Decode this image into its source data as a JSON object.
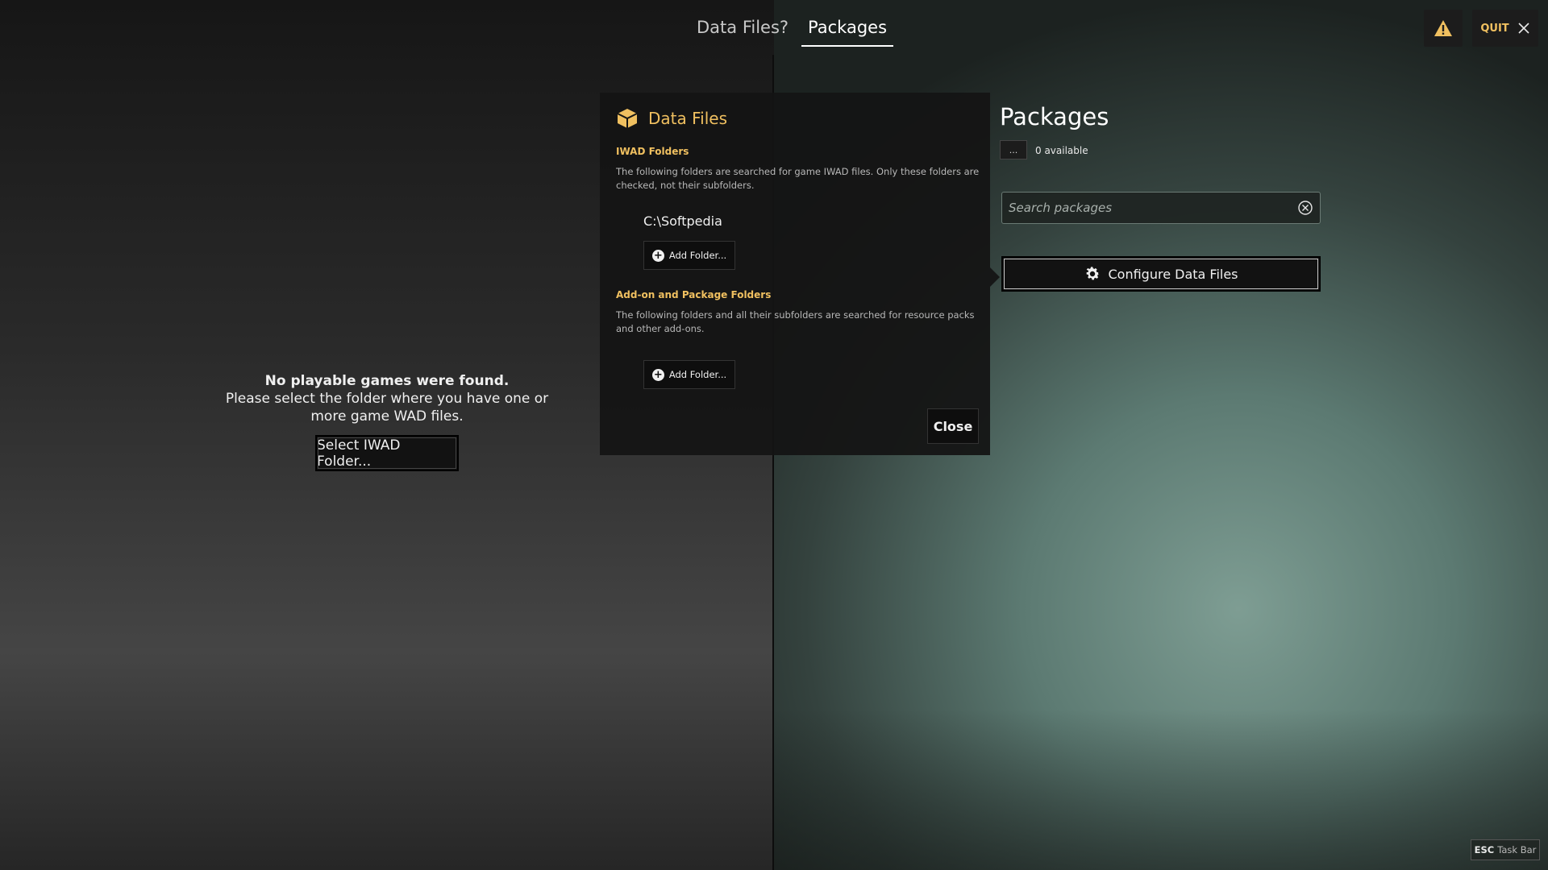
{
  "tabs": [
    {
      "label": "Data Files?",
      "active": false
    },
    {
      "label": "Packages",
      "active": true
    }
  ],
  "top_right": {
    "warning_icon": "warning-icon",
    "quit_label": "QUIT",
    "quit_icon": "close-icon"
  },
  "left_panel": {
    "message_bold": "No playable games were found.",
    "message_text": "Please select the folder where you have one or more game WAD files.",
    "select_button": "Select IWAD Folder..."
  },
  "dialog": {
    "title": "Data Files",
    "title_icon": "package-box-icon",
    "iwad": {
      "heading": "IWAD Folders",
      "description": "The following folders are searched for game IWAD files. Only these folders are checked, not their subfolders.",
      "folders": [
        "C:\\Softpedia"
      ],
      "add_button": "Add Folder..."
    },
    "addons": {
      "heading": "Add-on and Package Folders",
      "description": "The following folders and all their subfolders are searched for resource packs and other add-ons.",
      "add_button": "Add Folder..."
    },
    "close_button": "Close"
  },
  "packages": {
    "title": "Packages",
    "menu_button": "...",
    "count_text": "0 available",
    "search_placeholder": "Search packages",
    "configure_button": "Configure Data Files"
  },
  "footer": {
    "esc_key": "ESC",
    "esc_label": "Task Bar"
  },
  "colors": {
    "accent": "#f0c060",
    "panel_bg": "#141414",
    "text": "#f0f0f0"
  }
}
